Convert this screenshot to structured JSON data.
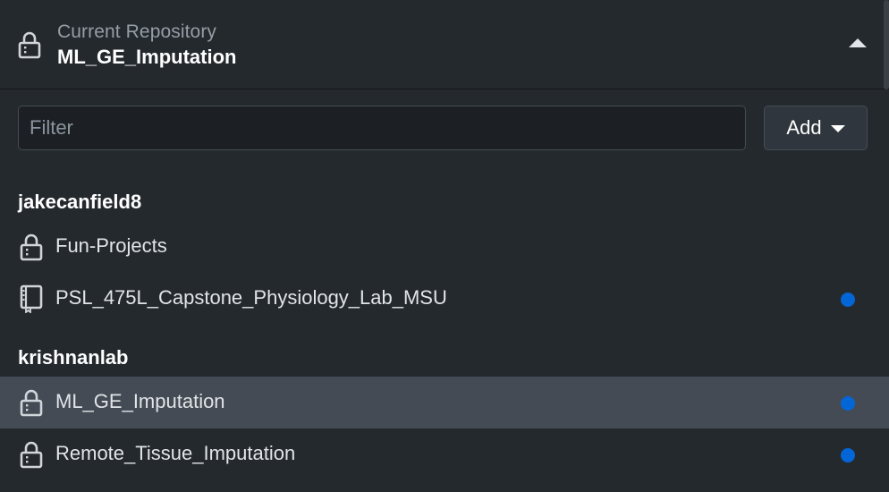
{
  "header": {
    "label": "Current Repository",
    "repo_name": "ML_GE_Imputation",
    "icon": "lock-icon",
    "toggle_icon": "caret-up-icon"
  },
  "filter": {
    "placeholder": "Filter",
    "value": ""
  },
  "add_button": {
    "label": "Add",
    "icon": "caret-down-icon"
  },
  "colors": {
    "background": "#24292e",
    "selected_row": "#444b54",
    "change_dot": "#0366d6"
  },
  "groups": [
    {
      "name": "jakecanfield8",
      "repos": [
        {
          "name": "Fun-Projects",
          "icon": "lock-icon",
          "has_changes": false,
          "selected": false
        },
        {
          "name": "PSL_475L_Capstone_Physiology_Lab_MSU",
          "icon": "repo-book-icon",
          "has_changes": true,
          "selected": false
        }
      ]
    },
    {
      "name": "krishnanlab",
      "repos": [
        {
          "name": "ML_GE_Imputation",
          "icon": "lock-icon",
          "has_changes": true,
          "selected": true
        },
        {
          "name": "Remote_Tissue_Imputation",
          "icon": "lock-icon",
          "has_changes": true,
          "selected": false
        }
      ]
    }
  ]
}
